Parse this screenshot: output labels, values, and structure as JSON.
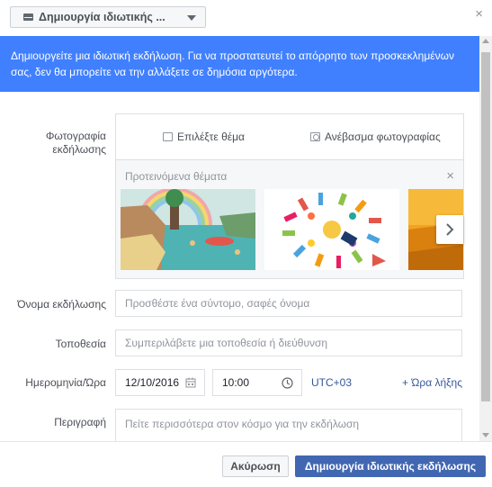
{
  "dialog": {
    "type_selector": "Δημιουργία ιδιωτικής ...",
    "close_symbol": "×"
  },
  "notice": "Δημιουργείτε μια ιδιωτική εκδήλωση. Για να προστατευτεί το απόρρητο των προσκεκλημένων σας, δεν θα μπορείτε να την αλλάξετε σε δημόσια αργότερα.",
  "form": {
    "photo": {
      "label": "Φωτογραφία εκδήλωσης",
      "choose_theme": "Επιλέξτε θέμα",
      "upload_photo": "Ανέβασμα φωτογραφίας",
      "suggested_title": "Προτεινόμενα θέματα",
      "close_symbol": "×"
    },
    "name": {
      "label": "Όνομα εκδήλωσης",
      "placeholder": "Προσθέστε ένα σύντομο, σαφές όνομα"
    },
    "location": {
      "label": "Τοποθεσία",
      "placeholder": "Συμπεριλάβετε μια τοποθεσία ή διεύθυνση"
    },
    "datetime": {
      "label": "Ημερομηνία/Ώρα",
      "date": "12/10/2016",
      "time": "10:00",
      "timezone": "UTC+03",
      "end_time_link": "+ Ώρα λήξης"
    },
    "description": {
      "label": "Περιγραφή",
      "placeholder": "Πείτε περισσότερα στον κόσμο για την εκδήλωση"
    }
  },
  "footer": {
    "cancel": "Ακύρωση",
    "create": "Δημιουργία ιδιωτικής εκδήλωσης"
  },
  "colors": {
    "notice_bg": "#4080ff",
    "primary": "#4267b2",
    "link": "#365899"
  }
}
